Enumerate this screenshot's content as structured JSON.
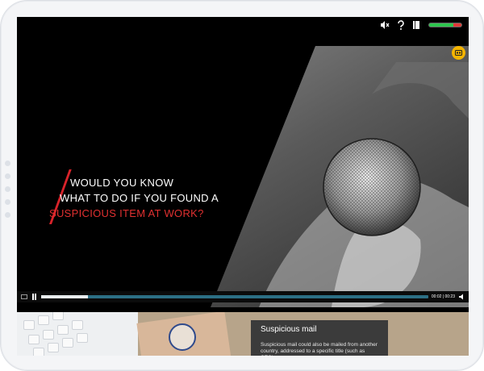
{
  "topbar": {
    "icons": [
      "mute-icon",
      "help-icon",
      "book-icon"
    ],
    "progress_fraction": 0.75,
    "progress_green": "#2fc650",
    "progress_red": "#e03a3a"
  },
  "stage": {
    "headline": [
      "Would you know",
      "what to do if you found a",
      "Suspicious item at work?"
    ],
    "accent_color": "#d8232a",
    "cc_badge_color": "#f4b400"
  },
  "player": {
    "time_current": "00:02",
    "time_total": "00:23",
    "time_separator": " | ",
    "played_fraction": 0.12
  },
  "card": {
    "title": "Suspicious mail",
    "body": "Suspicious mail could also be mailed from another country, addressed to a specific title (such as CEO)."
  }
}
